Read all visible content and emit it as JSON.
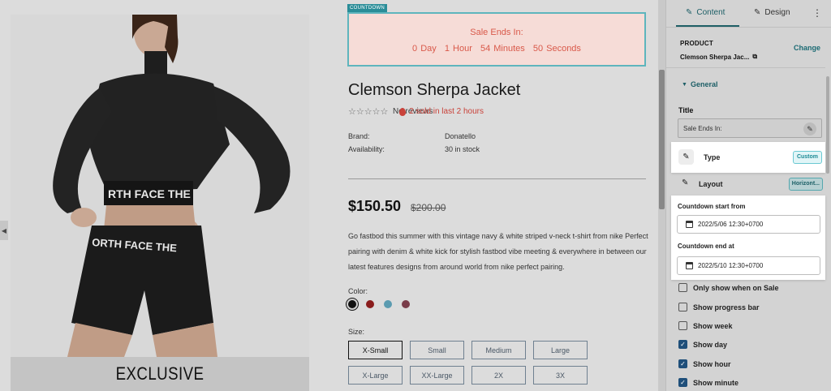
{
  "canvas": {
    "image_caption": "EXCLUSIVE",
    "countdown_tag": "COUNTDOWN",
    "countdown": {
      "title": "Sale Ends In:",
      "values": [
        "0 Day",
        "1 Hour",
        "54 Minutes",
        "50 Seconds"
      ]
    },
    "product": {
      "title": "Clemson Sherpa Jacket",
      "stars": "☆☆☆☆☆",
      "reviews": "No reviews",
      "sold": "2 sold in last 2 hours",
      "brand_label": "Brand:",
      "brand_value": "Donatello",
      "availability_label": "Availability:",
      "availability_value": "30 in stock",
      "price": "$150.50",
      "old_price": "$200.00",
      "description": "Go fastbod this summer with this vintage navy & white striped v-neck t-shirt from nike Perfect pairing with denim & white kick for stylish fastbod vibe meeting & everywhere in between our latest features designs from around world from nike perfect pairing.",
      "color_label": "Color:",
      "colors": [
        "#111111",
        "#8a1d1d",
        "#5b9bb0",
        "#7a3d4a"
      ],
      "size_label": "Size:",
      "sizes": [
        "X-Small",
        "Small",
        "Medium",
        "Large",
        "X-Large",
        "XX-Large",
        "2X",
        "3X"
      ]
    }
  },
  "panel": {
    "tabs": {
      "content": "Content",
      "design": "Design",
      "more": "⋮"
    },
    "product_label": "PRODUCT",
    "product_name": "Clemson Sherpa Jac...",
    "change": "Change",
    "general": "General",
    "title_label": "Title",
    "title_value": "Sale Ends In:",
    "type_label": "Type",
    "type_badge": "Custom",
    "layout_label": "Layout",
    "layout_badge": "Horizont...",
    "start_label": "Countdown start from",
    "start_value": "2022/5/06 12:30+0700",
    "end_label": "Countdown end at",
    "end_value": "2022/5/10 12:30+0700",
    "checks": [
      {
        "label": "Only show when on Sale",
        "checked": false
      },
      {
        "label": "Show progress bar",
        "checked": false
      },
      {
        "label": "Show week",
        "checked": false
      },
      {
        "label": "Show day",
        "checked": true
      },
      {
        "label": "Show hour",
        "checked": true
      },
      {
        "label": "Show minute",
        "checked": true
      }
    ]
  },
  "colors": {
    "accent": "#1c5e66",
    "countdown_bg": "#f6dcd7",
    "countdown_text": "#d9594a",
    "sold_text": "#c9423a",
    "checkbox_checked": "#1f4f7a"
  }
}
